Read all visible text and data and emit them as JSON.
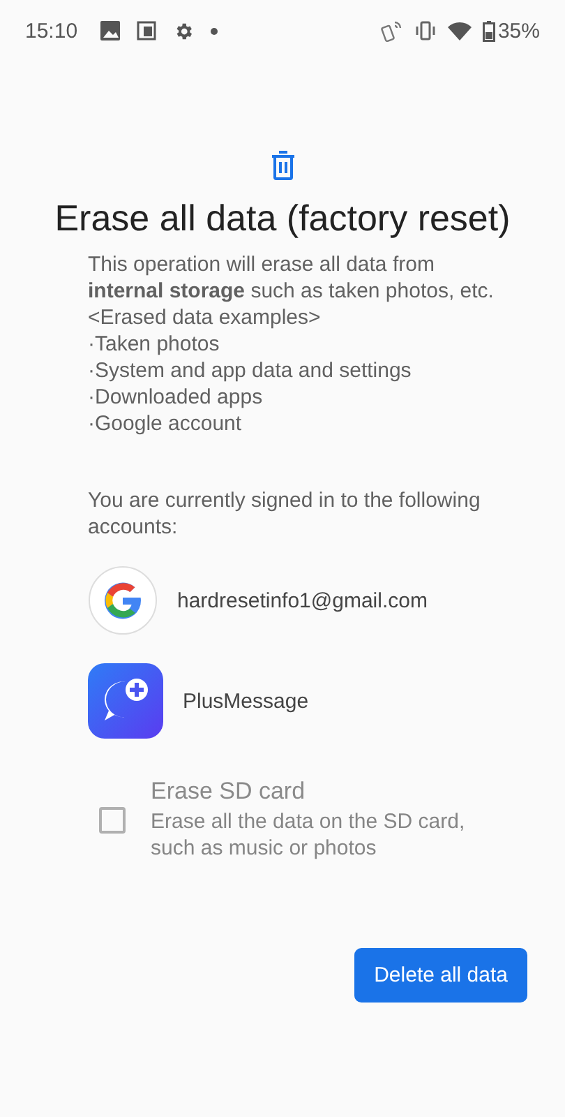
{
  "status_bar": {
    "time": "15:10",
    "battery": "35%"
  },
  "title": "Erase all data (factory reset)",
  "description": "This operation will erase all data from **internal storage** such as taken photos, etc.",
  "examples_heading": "<Erased data examples>",
  "examples": [
    "·Taken photos",
    "·System and app data and settings",
    "·Downloaded apps",
    "·Google account"
  ],
  "accounts_intro": "You are currently signed in to the following accounts:",
  "accounts": [
    {
      "kind": "google",
      "label": "hardresetinfo1@gmail.com"
    },
    {
      "kind": "plusmessage",
      "label": "PlusMessage"
    }
  ],
  "sd_option": {
    "title": "Erase SD card",
    "summary": "Erase all the data on the SD card, such as music or photos",
    "checked": false,
    "disabled": true
  },
  "button": "Delete all data"
}
